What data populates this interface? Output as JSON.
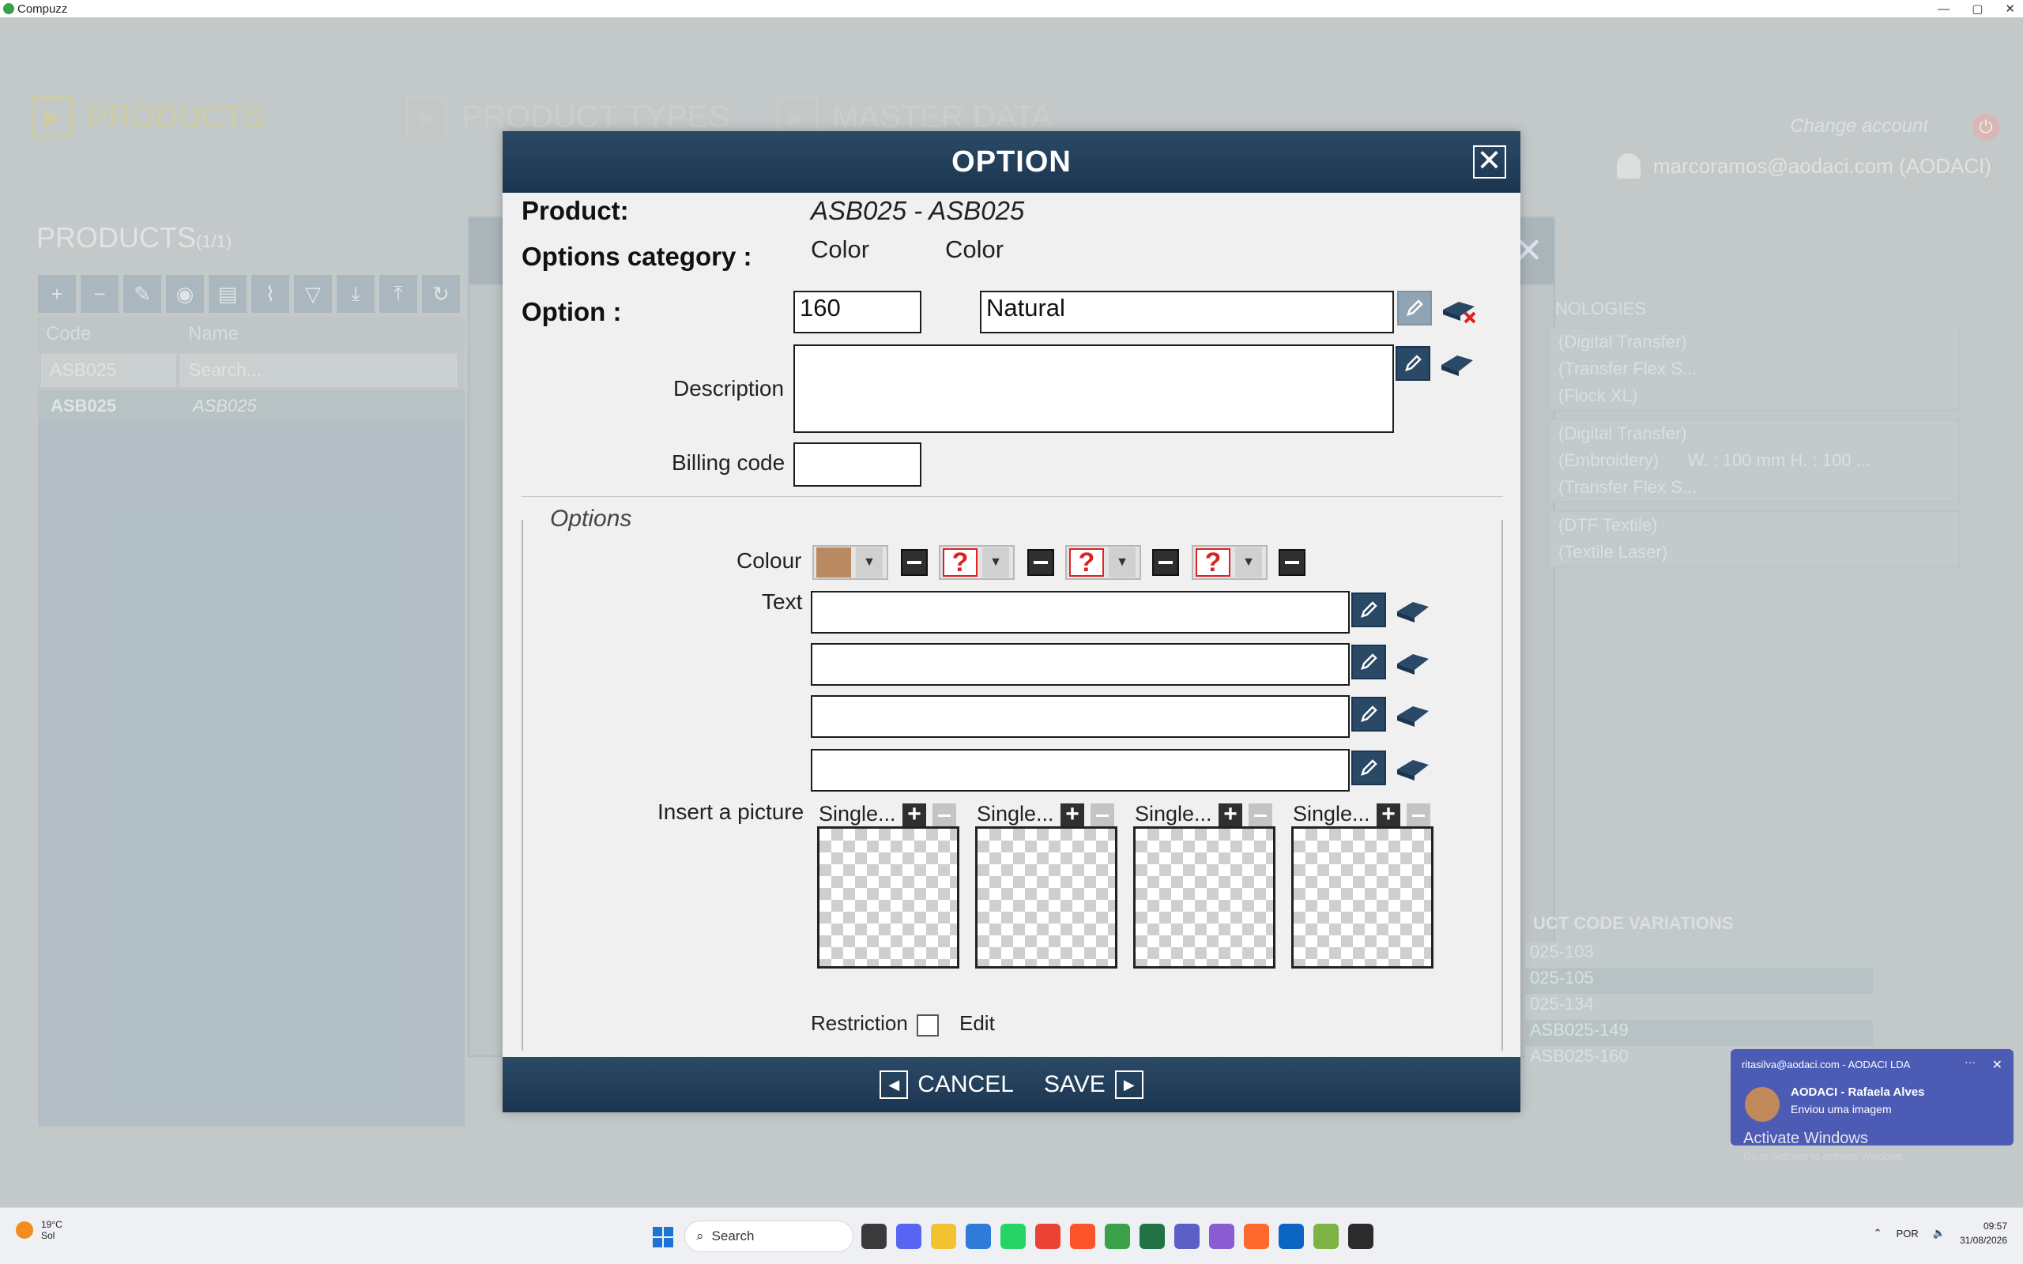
{
  "window": {
    "title": "Compuzz",
    "controls": [
      "—",
      "▢",
      "✕"
    ]
  },
  "background": {
    "nav": [
      {
        "label": "PRODUCTS",
        "active": true
      },
      {
        "label": "PRODUCT TYPES",
        "active": false
      },
      {
        "label": "MASTER DATA",
        "active": false
      }
    ],
    "change_account": "Change account",
    "user": "marcoramos@aodaci.com (AODACI)",
    "products_title": "PRODUCTS",
    "products_count": "(1/1)",
    "grid": {
      "columns": [
        "Code",
        "Name"
      ],
      "filter_code": "ASB025",
      "filter_name_placeholder": "Search...",
      "rows": [
        {
          "code": "ASB025",
          "name": "ASB025"
        }
      ]
    },
    "technologies_title": "NOLOGIES",
    "technologies": [
      [
        "(Digital Transfer)",
        "(Transfer Flex S...",
        "(Flock XL)"
      ],
      [
        "(Digital Transfer)",
        "(Embroidery)",
        "(Transfer Flex S..."
      ],
      [
        "(DTF Textile)",
        "(Textile Laser)"
      ]
    ],
    "tech_size_note": "W. : 100 mm H. : 100 ...",
    "code_variations_title": "UCT CODE VARIATIONS",
    "code_variations": [
      "025-103",
      "025-105",
      "025-134",
      "ASB025-149",
      "ASB025-160"
    ]
  },
  "modal": {
    "title": "OPTION",
    "product_label": "Product:",
    "product_value": "ASB025 - ASB025",
    "category_label": "Options category :",
    "category_code": "Color",
    "category_name": "Color",
    "option_label": "Option :",
    "option_code": "160",
    "option_name": "Natural",
    "description_label": "Description",
    "description_value": "",
    "billing_label": "Billing code",
    "billing_value": "",
    "options_legend": "Options",
    "colour_label": "Colour",
    "colours": [
      {
        "type": "swatch",
        "color": "#b98a62"
      },
      {
        "type": "unknown",
        "symbol": "?"
      },
      {
        "type": "unknown",
        "symbol": "?"
      },
      {
        "type": "unknown",
        "symbol": "?"
      }
    ],
    "text_label": "Text",
    "text_values": [
      "",
      "",
      "",
      ""
    ],
    "picture_label": "Insert a picture",
    "pictures": [
      "Single...",
      "Single...",
      "Single...",
      "Single..."
    ],
    "restriction_label": "Restriction",
    "edit_label": "Edit",
    "cancel_label": "CANCEL",
    "save_label": "SAVE"
  },
  "notification": {
    "from": "ritasilva@aodaci.com - AODACI LDA",
    "sender": "AODACI - Rafaela Alves",
    "message": "Enviou uma imagem",
    "watermark_title": "Activate Windows",
    "watermark_sub": "Go to Settings to activate Windows."
  },
  "taskbar": {
    "temperature": "19°C",
    "condition": "Sol",
    "search_placeholder": "Search",
    "language": "POR",
    "time": "09:57",
    "date": "31/08/2026"
  },
  "colors": {
    "header": "#1b3550",
    "accent_product": "#d9d59a"
  }
}
